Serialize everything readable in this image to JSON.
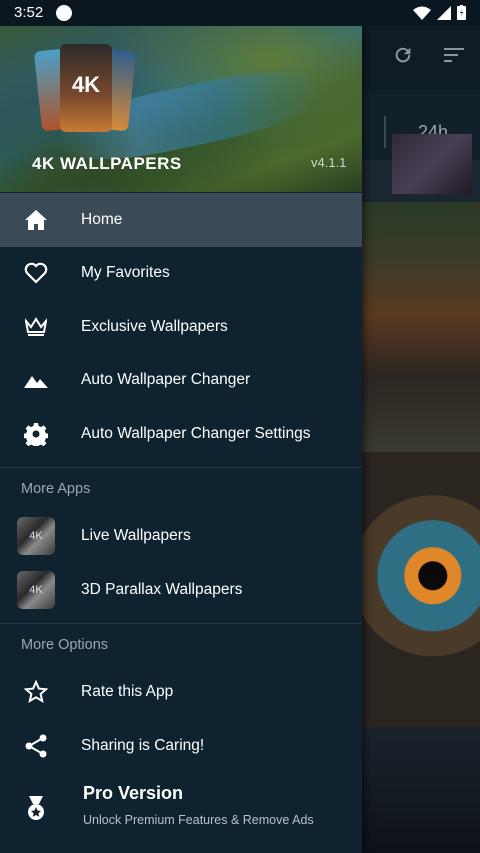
{
  "status_bar": {
    "time": "3:52"
  },
  "header": {
    "title": "4K WALLPAPERS",
    "version": "v4.1.1",
    "logo_text": "4K"
  },
  "menu": [
    {
      "label": "Home",
      "icon": "home-icon",
      "active": true
    },
    {
      "label": "My Favorites",
      "icon": "heart-icon"
    },
    {
      "label": "Exclusive Wallpapers",
      "icon": "crown-icon"
    },
    {
      "label": "Auto Wallpaper Changer",
      "icon": "landscape-icon"
    },
    {
      "label": "Auto Wallpaper Changer Settings",
      "icon": "gear-icon"
    }
  ],
  "more_apps": {
    "title": "More Apps",
    "items": [
      {
        "label": "Live Wallpapers",
        "thumb_text": "4K"
      },
      {
        "label": "3D Parallax Wallpapers",
        "thumb_text": "4K"
      }
    ]
  },
  "more_options": {
    "title": "More Options",
    "items": [
      {
        "label": "Rate this App",
        "icon": "star-icon"
      },
      {
        "label": "Sharing is Caring!",
        "icon": "share-icon"
      }
    ]
  },
  "pro": {
    "title": "Pro Version",
    "subtitle": "Unlock Premium Features & Remove Ads",
    "icon": "medal-icon"
  },
  "background": {
    "filter_label": "24h"
  }
}
